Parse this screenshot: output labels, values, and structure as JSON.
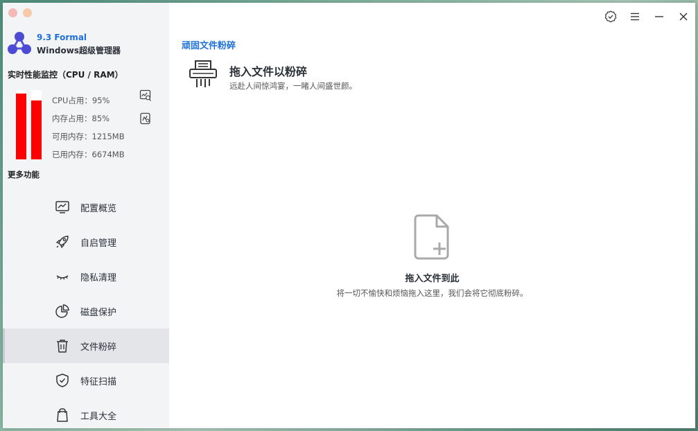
{
  "app": {
    "version": "9.3 Formal",
    "name": "Windows超级管理器"
  },
  "monitor": {
    "title": "实时性能监控（CPU / RAM）",
    "cpu_percent": 95,
    "mem_percent": 85,
    "cpu_text": "CPU占用：95%",
    "mem_text": "内存占用：85%",
    "avail_text": "可用内存：1215MB",
    "used_text": "已用内存：6674MB",
    "bar_color": "#ff0000",
    "more_label": "更多功能"
  },
  "nav": [
    {
      "label": "配置概览",
      "icon": "monitor-chart-icon",
      "active": false
    },
    {
      "label": "自启管理",
      "icon": "rocket-icon",
      "active": false
    },
    {
      "label": "隐私清理",
      "icon": "closed-eye-icon",
      "active": false
    },
    {
      "label": "磁盘保护",
      "icon": "pie-chart-icon",
      "active": false
    },
    {
      "label": "文件粉碎",
      "icon": "trash-icon",
      "active": true
    },
    {
      "label": "特征扫描",
      "icon": "shield-check-icon",
      "active": false
    },
    {
      "label": "工具大全",
      "icon": "bag-icon",
      "active": false
    }
  ],
  "main": {
    "page_title": "顽固文件粉碎",
    "head_title": "拖入文件以粉碎",
    "head_sub": "远赴人间惊鸿宴，一睹人间盛世颜。",
    "drop_title": "拖入文件到此",
    "drop_sub": "将一切不愉快和烦恼拖入这里，我们会将它彻底粉碎。"
  },
  "colors": {
    "accent": "#1e6fd9",
    "sidebar_bg": "#f3f4f6",
    "active_item_bg": "#e4e5e8",
    "traffic_dot": "#f4b8b8"
  }
}
